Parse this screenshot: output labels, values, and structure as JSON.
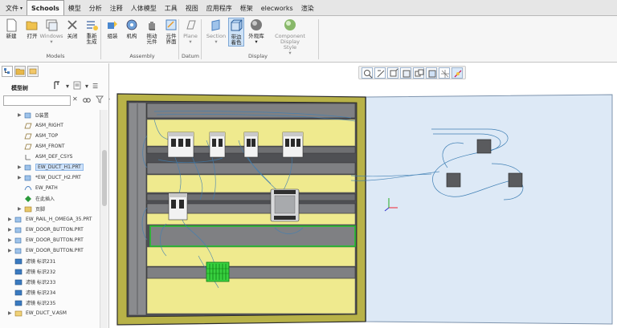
{
  "tabs": [
    {
      "label": "文件",
      "active": false,
      "has_caret": true
    },
    {
      "label": "Schools",
      "active": true,
      "has_caret": false
    },
    {
      "label": "模型",
      "active": false,
      "has_caret": false
    },
    {
      "label": "分析",
      "active": false,
      "has_caret": false
    },
    {
      "label": "注释",
      "active": false,
      "has_caret": false
    },
    {
      "label": "人体模型",
      "active": false,
      "has_caret": false
    },
    {
      "label": "工具",
      "active": false,
      "has_caret": false
    },
    {
      "label": "视图",
      "active": false,
      "has_caret": false
    },
    {
      "label": "应用程序",
      "active": false,
      "has_caret": false
    },
    {
      "label": "框架",
      "active": false,
      "has_caret": false
    },
    {
      "label": "elecworks",
      "active": false,
      "has_caret": false
    },
    {
      "label": "渲染",
      "active": false,
      "has_caret": false
    }
  ],
  "ribbon": {
    "buttons": [
      {
        "name": "new",
        "l1": "新建",
        "l2": "",
        "icon": "new-file-icon"
      },
      {
        "name": "open",
        "l1": "打开",
        "l2": "",
        "icon": "open-folder-icon"
      },
      {
        "name": "windows",
        "l1": "Windows",
        "l2": "",
        "icon": "windows-icon"
      },
      {
        "name": "close",
        "l1": "关闭",
        "l2": "",
        "icon": "close-icon"
      },
      {
        "name": "regenerate",
        "l1": "重新",
        "l2": "生成",
        "icon": "regenerate-icon"
      },
      {
        "name": "assemble",
        "l1": "组装",
        "l2": "",
        "icon": "assemble-icon"
      },
      {
        "name": "mechanism",
        "l1": "机构",
        "l2": "",
        "icon": "mechanism-gear-icon"
      },
      {
        "name": "drag-components",
        "l1": "拖动",
        "l2": "元件",
        "icon": "drag-hand-icon"
      },
      {
        "name": "component-interface",
        "l1": "元件",
        "l2": "界面",
        "icon": "component-interface-icon"
      },
      {
        "name": "plane",
        "l1": "Plane",
        "l2": "",
        "icon": "plane-icon"
      },
      {
        "name": "section",
        "l1": "Section",
        "l2": "",
        "icon": "section-icon"
      },
      {
        "name": "shading-edges",
        "l1": "带边",
        "l2": "着色",
        "icon": "shading-edges-icon"
      },
      {
        "name": "appearance-gallery",
        "l1": "外观库",
        "l2": "",
        "icon": "appearance-sphere-icon"
      },
      {
        "name": "component-display-style",
        "l1": "Component",
        "l2": "Display Style",
        "icon": "display-style-sphere-icon"
      }
    ],
    "groups": [
      "Models",
      "Assembly",
      "Datum",
      "Display"
    ]
  },
  "left_panel": {
    "title": "模型树",
    "search_placeholder": "",
    "tree": [
      {
        "label": "D装置",
        "indent": 1,
        "expander": "▶",
        "icon": "part-icon",
        "selected": false
      },
      {
        "label": "ASM_RIGHT",
        "indent": 1,
        "expander": "",
        "icon": "datum-plane-icon",
        "selected": false
      },
      {
        "label": "ASM_TOP",
        "indent": 1,
        "expander": "",
        "icon": "datum-plane-icon",
        "selected": false
      },
      {
        "label": "ASM_FRONT",
        "indent": 1,
        "expander": "",
        "icon": "datum-plane-icon",
        "selected": false
      },
      {
        "label": "ASM_DEF_CSYS",
        "indent": 1,
        "expander": "",
        "icon": "csys-icon",
        "selected": false
      },
      {
        "label": "EW_DUCT_H1.PRT",
        "indent": 1,
        "expander": "▶",
        "icon": "part-icon",
        "selected": true
      },
      {
        "label": "*EW_DUCT_H2.PRT",
        "indent": 1,
        "expander": "▶",
        "icon": "part-icon",
        "selected": false
      },
      {
        "label": "EW_PATH",
        "indent": 1,
        "expander": "",
        "icon": "path-icon",
        "selected": false
      },
      {
        "label": "在此插入",
        "indent": 1,
        "expander": "",
        "icon": "insert-here-icon",
        "selected": false
      },
      {
        "label": "页脚",
        "indent": 1,
        "expander": "▶",
        "icon": "footer-icon",
        "selected": false
      },
      {
        "label": "EW_RAIL_H_OMEGA_35.PRT",
        "indent": 0,
        "expander": "▶",
        "icon": "part-icon",
        "selected": false
      },
      {
        "label": "EW_DOOR_BUTTON.PRT",
        "indent": 0,
        "expander": "▶",
        "icon": "part-icon",
        "selected": false
      },
      {
        "label": "EW_DOOR_BUTTON.PRT",
        "indent": 0,
        "expander": "▶",
        "icon": "part-icon",
        "selected": false
      },
      {
        "label": "EW_DOOR_BUTTON.PRT",
        "indent": 0,
        "expander": "▶",
        "icon": "part-icon",
        "selected": false
      },
      {
        "label": "滤镜 标识231",
        "indent": 0,
        "expander": "",
        "icon": "feature-icon",
        "selected": false
      },
      {
        "label": "滤镜 标识232",
        "indent": 0,
        "expander": "",
        "icon": "feature-icon",
        "selected": false
      },
      {
        "label": "滤镜 标识233",
        "indent": 0,
        "expander": "",
        "icon": "feature-icon",
        "selected": false
      },
      {
        "label": "滤镜 标识234",
        "indent": 0,
        "expander": "",
        "icon": "feature-icon",
        "selected": false
      },
      {
        "label": "滤镜 标识235",
        "indent": 0,
        "expander": "",
        "icon": "feature-icon",
        "selected": false
      },
      {
        "label": "EW_DUCT_V.ASM",
        "indent": 0,
        "expander": "▶",
        "icon": "assembly-icon",
        "selected": false
      }
    ]
  },
  "view_toolbar": [
    {
      "name": "refit",
      "icon": "refit-icon",
      "on": false
    },
    {
      "name": "zoom-in",
      "icon": "zoom-in-icon",
      "on": false
    },
    {
      "name": "zoom-out",
      "icon": "zoom-out-icon",
      "on": false
    },
    {
      "name": "repaint",
      "icon": "repaint-icon",
      "on": false
    },
    {
      "name": "saved-views",
      "icon": "saved-views-icon",
      "on": false
    },
    {
      "name": "display-style",
      "icon": "display-style-icon",
      "on": false
    },
    {
      "name": "datum-display",
      "icon": "datum-display-icon",
      "on": false
    },
    {
      "name": "spin-center",
      "icon": "spin-center-icon",
      "on": true
    }
  ],
  "colors": {
    "panel_yellow": "#efea8e",
    "frame_olive": "#b8b248",
    "rail_gray": "#7f8083",
    "door_blue": "#dde9f6",
    "wire_blue": "#3f7fb4",
    "highlight_green": "#22c02a",
    "selection_blue": "#cfe3fb"
  }
}
